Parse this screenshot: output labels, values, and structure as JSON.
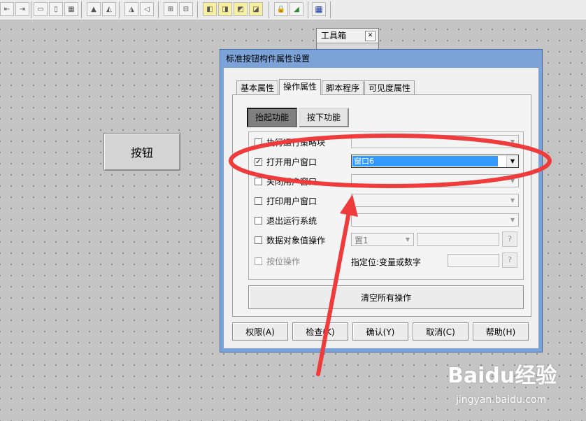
{
  "toolbar": {
    "icons": [
      "align-left-icon",
      "align-right-icon",
      "size-icon",
      "size-icon",
      "size-icon",
      "flip-icon",
      "flip-icon",
      "flip-icon",
      "flip-icon",
      "group-icon",
      "ungroup-icon",
      "layer-icon",
      "layer-icon",
      "layer-icon",
      "layer-icon",
      "lock-icon",
      "fill-icon",
      "palette-icon"
    ]
  },
  "canvas": {
    "button_label": "按钮"
  },
  "toolbox": {
    "title": "工具箱"
  },
  "dialog": {
    "title": "标准按钮构件属性设置",
    "tabs": [
      "基本属性",
      "操作属性",
      "脚本程序",
      "可见度属性"
    ],
    "active_tab": "操作属性",
    "subtabs": [
      "抬起功能",
      "按下功能"
    ],
    "active_subtab": "抬起功能",
    "ops": [
      {
        "label": "执行运行策略块",
        "checked": false
      },
      {
        "label": "打开用户窗口",
        "checked": true,
        "value": "窗口6"
      },
      {
        "label": "关闭用户窗口",
        "checked": false
      },
      {
        "label": "打印用户窗口",
        "checked": false
      },
      {
        "label": "退出运行系统",
        "checked": false
      },
      {
        "label": "数据对象值操作",
        "checked": false,
        "value": "置1"
      },
      {
        "label": "按位操作",
        "checked": false,
        "disabled": true,
        "note": "指定位:变量或数字"
      }
    ],
    "question_mark": "?",
    "clear_label": "清空所有操作",
    "footer": [
      "权限(A)",
      "检查(K)",
      "确认(Y)",
      "取消(C)",
      "帮助(H)"
    ]
  },
  "watermark": {
    "brand": "Baidu经验",
    "url": "jingyan.baidu.com"
  },
  "colors": {
    "annotation": "#ef3b3b",
    "dialog_frame": "#7ba3d8",
    "selection": "#3399ff"
  }
}
